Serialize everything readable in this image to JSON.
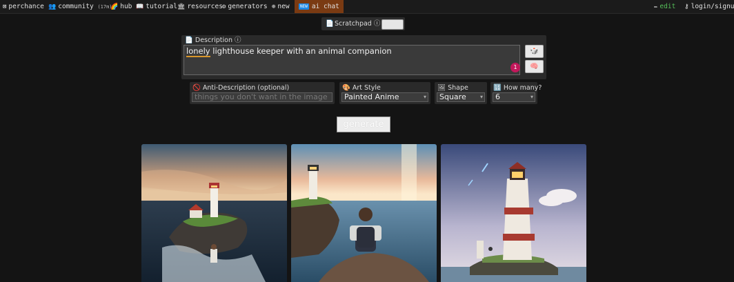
{
  "nav": {
    "perchance": "perchance",
    "community": "community",
    "community_badge": "(17m)",
    "hub": "hub",
    "tutorial": "tutorial",
    "resources": "resources",
    "generators": "generators",
    "new": "new",
    "ai_chat_badge": "NEW",
    "ai_chat": "ai chat",
    "edit": "edit",
    "login": "login/signup"
  },
  "scratchpad": {
    "label": "Scratchpad"
  },
  "description": {
    "label": "Description",
    "value_first": "lonely",
    "value_rest": " lighthouse keeper with an animal companion",
    "notification_count": "1"
  },
  "anti_description": {
    "label": "Anti-Description (optional)",
    "placeholder": "things you don't want in the image"
  },
  "art_style": {
    "label": "Art Style",
    "value": "Painted Anime"
  },
  "shape": {
    "label": "Shape",
    "value": "Square"
  },
  "how_many": {
    "label": "How many?",
    "value": "6"
  },
  "generate_button": "generate",
  "colors": {
    "background": "#141414",
    "ai_chat_bg": "#7a3a12",
    "edit": "#56c05a",
    "notification": "#c2185b"
  }
}
